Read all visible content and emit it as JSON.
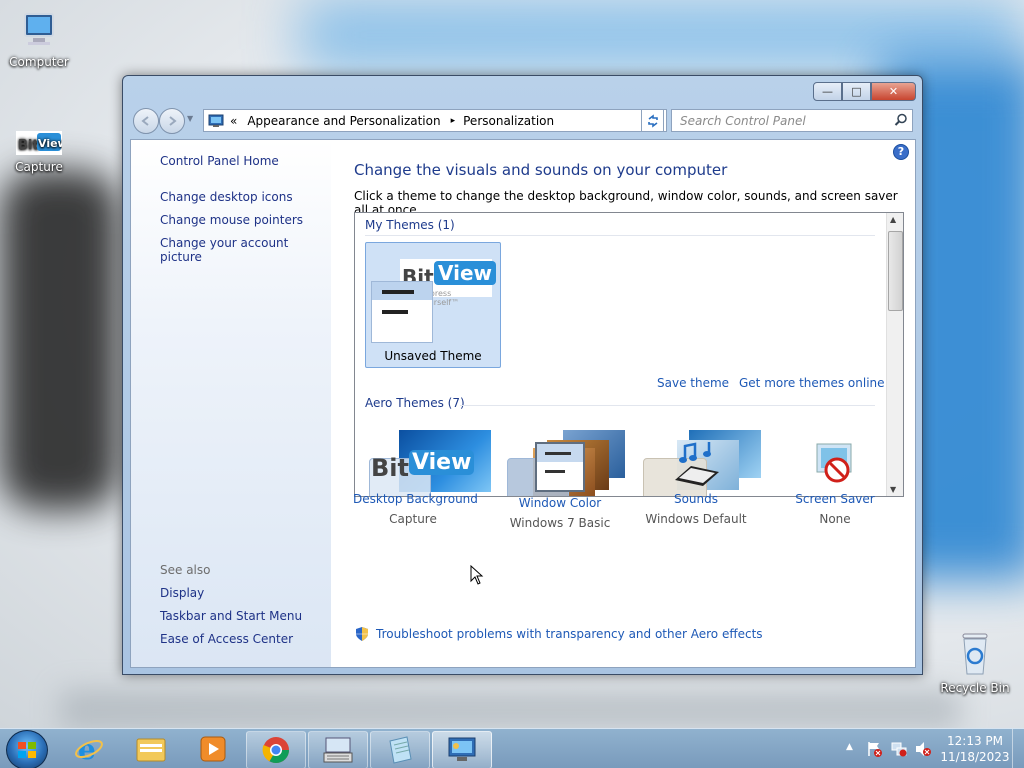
{
  "desktop": {
    "icons": [
      {
        "label": "Computer"
      },
      {
        "label": "Capture"
      },
      {
        "label": "Recycle Bin"
      }
    ]
  },
  "window": {
    "buttons": {
      "minimize": "—",
      "maximize": "□",
      "close": "✕"
    },
    "address": {
      "chevron": "«",
      "crumb1": "Appearance and Personalization",
      "sep": "▸",
      "crumb2": "Personalization"
    },
    "search_placeholder": "Search Control Panel",
    "help": "?"
  },
  "leftpane": {
    "home": "Control Panel Home",
    "links": [
      "Change desktop icons",
      "Change mouse pointers",
      "Change your account picture"
    ],
    "see_also_label": "See also",
    "see_also": [
      "Display",
      "Taskbar and Start Menu",
      "Ease of Access Center"
    ]
  },
  "main": {
    "title": "Change the visuals and sounds on your computer",
    "subtitle": "Click a theme to change the desktop background, window color, sounds, and screen saver all at once.",
    "my_themes_label": "My Themes (1)",
    "unsaved_theme": "Unsaved Theme",
    "save_theme": "Save theme",
    "get_more": "Get more themes online",
    "aero_themes_label": "Aero Themes (7)",
    "thumb_logo": {
      "bit": "Bit",
      "view": "View",
      "tag": "Express Yourself™"
    },
    "bottom": [
      {
        "title": "Desktop Background",
        "value": "Capture"
      },
      {
        "title": "Window Color",
        "value": "Windows 7 Basic"
      },
      {
        "title": "Sounds",
        "value": "Windows Default"
      },
      {
        "title": "Screen Saver",
        "value": "None"
      }
    ],
    "troubleshoot": "Troubleshoot problems with transparency and other Aero effects"
  },
  "taskbar": {
    "clock_time": "12:13 PM",
    "clock_date": "11/18/2023",
    "tray_arrow": "▲"
  },
  "colors": {
    "link": "#1e59b6",
    "title": "#1e3b8c",
    "nav_link": "#1e3287"
  }
}
